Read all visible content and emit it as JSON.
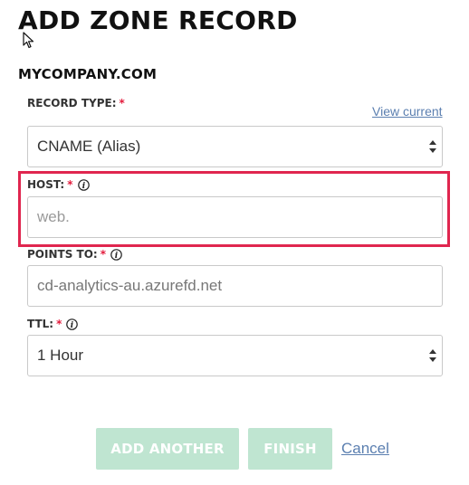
{
  "page": {
    "title": "ADD ZONE RECORD"
  },
  "domain": {
    "name": "MYCOMPANY.COM"
  },
  "required_marker": "*",
  "record_type": {
    "label": "RECORD TYPE:",
    "view_current_label": "View current",
    "selected": "CNAME (Alias)"
  },
  "host": {
    "label": "HOST:",
    "placeholder": "web."
  },
  "points_to": {
    "label": "POINTS TO:",
    "placeholder": "cd-analytics-au.azurefd.net"
  },
  "ttl": {
    "label": "TTL:",
    "selected": "1 Hour"
  },
  "actions": {
    "add_another_label": "ADD ANOTHER",
    "finish_label": "FINISH",
    "cancel_label": "Cancel"
  },
  "colors": {
    "accent_required": "#e31b3c",
    "highlight_border": "#e0264f",
    "button_disabled_bg": "#bfe5d1",
    "link": "#5b7fb0"
  },
  "icons": {
    "info": "info-icon",
    "select_arrows": "select-arrows-icon",
    "cursor": "mouse-cursor-icon"
  }
}
